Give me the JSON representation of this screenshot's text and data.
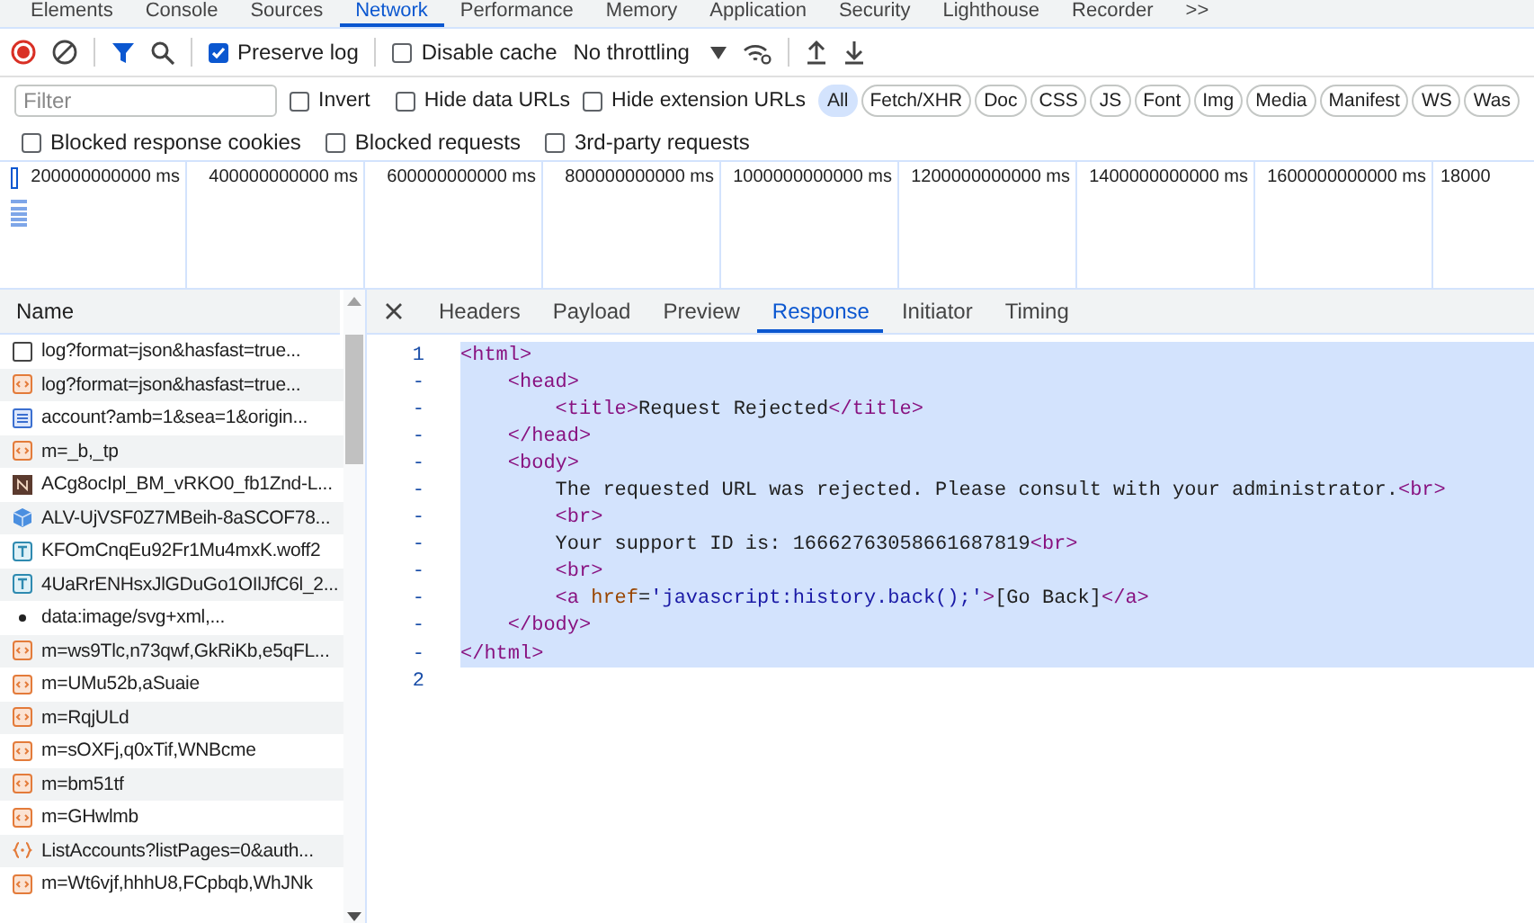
{
  "panel_tabs": [
    {
      "label": "Elements",
      "selected": false
    },
    {
      "label": "Console",
      "selected": false
    },
    {
      "label": "Sources",
      "selected": false
    },
    {
      "label": "Network",
      "selected": true
    },
    {
      "label": "Performance",
      "selected": false
    },
    {
      "label": "Memory",
      "selected": false
    },
    {
      "label": "Application",
      "selected": false
    },
    {
      "label": "Security",
      "selected": false
    },
    {
      "label": "Lighthouse",
      "selected": false
    },
    {
      "label": "Recorder",
      "selected": false
    }
  ],
  "more_tabs": ">>",
  "toolbar": {
    "preserve_log": {
      "label": "Preserve log",
      "checked": true
    },
    "disable_cache": {
      "label": "Disable cache",
      "checked": false
    },
    "throttling": "No throttling"
  },
  "filter_bar": {
    "placeholder": "Filter",
    "invert": {
      "label": "Invert",
      "checked": false
    },
    "hide_data_urls": {
      "label": "Hide data URLs",
      "checked": false
    },
    "hide_extension_urls": {
      "label": "Hide extension URLs",
      "checked": false
    },
    "types": [
      {
        "label": "All",
        "selected": true
      },
      {
        "label": "Fetch/XHR",
        "selected": false
      },
      {
        "label": "Doc",
        "selected": false
      },
      {
        "label": "CSS",
        "selected": false
      },
      {
        "label": "JS",
        "selected": false
      },
      {
        "label": "Font",
        "selected": false
      },
      {
        "label": "Img",
        "selected": false
      },
      {
        "label": "Media",
        "selected": false
      },
      {
        "label": "Manifest",
        "selected": false
      },
      {
        "label": "WS",
        "selected": false
      },
      {
        "label": "Was",
        "selected": false
      }
    ]
  },
  "extra_filters": [
    {
      "label": "Blocked response cookies",
      "checked": false
    },
    {
      "label": "Blocked requests",
      "checked": false
    },
    {
      "label": "3rd-party requests",
      "checked": false
    }
  ],
  "overview": {
    "ticks": [
      "200000000000 ms",
      "400000000000 ms",
      "600000000000 ms",
      "800000000000 ms",
      "1000000000000 ms",
      "1200000000000 ms",
      "1400000000000 ms",
      "1600000000000 ms",
      "18000"
    ]
  },
  "requests": {
    "column": "Name",
    "rows": [
      {
        "name": "log?format=json&hasfast=true...",
        "kind": "blank"
      },
      {
        "name": "log?format=json&hasfast=true...",
        "kind": "script"
      },
      {
        "name": "account?amb=1&sea=1&origin...",
        "kind": "document"
      },
      {
        "name": "m=_b,_tp",
        "kind": "script"
      },
      {
        "name": "ACg8ocIpl_BM_vRKO0_fb1Znd-L...",
        "kind": "image"
      },
      {
        "name": "ALV-UjVSF0Z7MBeih-8aSCOF78...",
        "kind": "cube"
      },
      {
        "name": "KFOmCnqEu92Fr1Mu4mxK.woff2",
        "kind": "font"
      },
      {
        "name": "4UaRrENHsxJlGDuGo1OIlJfC6l_2...",
        "kind": "font"
      },
      {
        "name": "data:image/svg+xml,...",
        "kind": "dot"
      },
      {
        "name": "m=ws9Tlc,n73qwf,GkRiKb,e5qFL...",
        "kind": "script"
      },
      {
        "name": "m=UMu52b,aSuaie",
        "kind": "script"
      },
      {
        "name": "m=RqjULd",
        "kind": "script"
      },
      {
        "name": "m=sOXFj,q0xTif,WNBcme",
        "kind": "script"
      },
      {
        "name": "m=bm51tf",
        "kind": "script"
      },
      {
        "name": "m=GHwlmb",
        "kind": "script"
      },
      {
        "name": "ListAccounts?listPages=0&auth...",
        "kind": "json"
      },
      {
        "name": "m=Wt6vjf,hhhU8,FCpbqb,WhJNk",
        "kind": "script"
      }
    ]
  },
  "detail": {
    "tabs": [
      {
        "label": "Headers",
        "selected": false
      },
      {
        "label": "Payload",
        "selected": false
      },
      {
        "label": "Preview",
        "selected": false
      },
      {
        "label": "Response",
        "selected": true
      },
      {
        "label": "Initiator",
        "selected": false
      },
      {
        "label": "Timing",
        "selected": false
      }
    ],
    "code": [
      {
        "number": "1",
        "tokens": [
          {
            "kind": "tag",
            "text": "<html>"
          }
        ],
        "children": [
          {
            "number": "-",
            "tokens": [
              {
                "kind": "tag",
                "text": "<head>"
              }
            ],
            "children": [
              {
                "number": "-",
                "tokens": [
                  {
                    "kind": "tag",
                    "text": "<title>"
                  },
                  {
                    "kind": "text",
                    "text": "Request Rejected"
                  },
                  {
                    "kind": "tag",
                    "text": "</title>"
                  }
                ]
              }
            ]
          },
          {
            "number": "-",
            "tokens": [
              {
                "kind": "tag",
                "text": "</head>"
              }
            ]
          },
          {
            "number": "-",
            "tokens": [
              {
                "kind": "tag",
                "text": "<body>"
              }
            ],
            "children": [
              {
                "number": "-",
                "tokens": [
                  {
                    "kind": "text",
                    "text": "The requested URL was rejected. Please consult with your administrator."
                  },
                  {
                    "kind": "tag",
                    "text": "<br>"
                  }
                ]
              },
              {
                "number": "-",
                "tokens": [
                  {
                    "kind": "tag",
                    "text": "<br>"
                  }
                ]
              },
              {
                "number": "-",
                "tokens": [
                  {
                    "kind": "text",
                    "text": "Your support ID is: 16662763058661687819"
                  },
                  {
                    "kind": "tag",
                    "text": "<br>"
                  }
                ]
              },
              {
                "number": "-",
                "tokens": [
                  {
                    "kind": "tag",
                    "text": "<br>"
                  }
                ]
              },
              {
                "number": "-",
                "tokens": [
                  {
                    "kind": "tag",
                    "text": "<a "
                  },
                  {
                    "kind": "attr",
                    "text": "href"
                  },
                  {
                    "kind": "text",
                    "text": "="
                  },
                  {
                    "kind": "string",
                    "text": "'javascript:history.back();'"
                  },
                  {
                    "kind": "tag",
                    "text": ">"
                  },
                  {
                    "kind": "text",
                    "text": "[Go Back]"
                  },
                  {
                    "kind": "tag",
                    "text": "</a>"
                  }
                ]
              }
            ]
          },
          {
            "number": "-",
            "tokens": [
              {
                "kind": "tag",
                "text": "</body>"
              }
            ]
          }
        ]
      },
      {
        "number": "-",
        "tokens": [
          {
            "kind": "tag",
            "text": "</html>"
          }
        ]
      },
      {
        "number": "2",
        "selected": false
      }
    ]
  }
}
